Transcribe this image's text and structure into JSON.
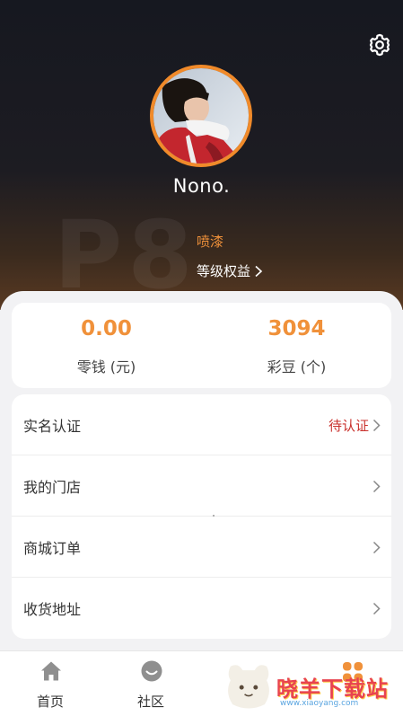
{
  "profile": {
    "username": "Nono.",
    "level_code": "P8",
    "level_name": "喷漆",
    "level_benefit_label": "等级权益"
  },
  "wallet": {
    "balance_value": "0.00",
    "balance_label": "零钱 (元)",
    "beans_value": "3094",
    "beans_label": "彩豆 (个)"
  },
  "menu": {
    "items": [
      {
        "label": "实名认证",
        "status": "待认证"
      },
      {
        "label": "我的门店",
        "status": ""
      },
      {
        "label": "商城订单",
        "status": ""
      },
      {
        "label": "收货地址",
        "status": ""
      }
    ]
  },
  "tabbar": {
    "home": "首页",
    "community": "社区"
  },
  "watermark": {
    "text": "晓羊下载站",
    "url": "www.xiaoyang.com"
  },
  "colors": {
    "accent": "#f0913a",
    "status_red": "#c9302c",
    "header_dark": "#1d1c22"
  },
  "icons": {
    "settings": "gear-icon",
    "home": "home-icon",
    "community": "smile-icon",
    "chevron": "chevron-right-icon"
  }
}
